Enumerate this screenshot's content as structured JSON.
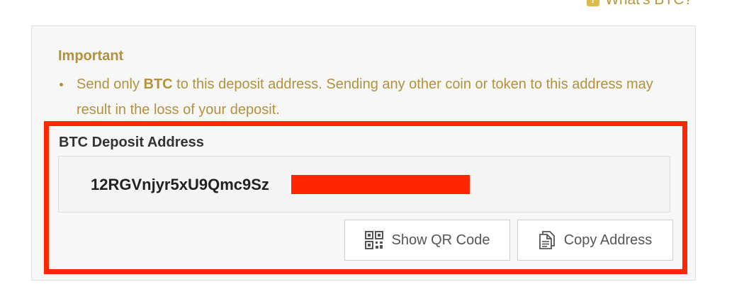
{
  "top_link": {
    "label": "What's BTC?",
    "icon": "question-icon"
  },
  "important": {
    "title": "Important",
    "text_before": "Send only ",
    "coin": "BTC",
    "text_after": " to this deposit address. Sending any other coin or token to this address may result in the loss of your deposit."
  },
  "deposit": {
    "label": "BTC Deposit Address",
    "address_visible": "12RGVnjyr5xU9Qmc9Sz"
  },
  "buttons": {
    "show_qr": "Show QR Code",
    "copy_address": "Copy Address"
  },
  "colors": {
    "accent_gold": "#b5913a",
    "highlight_red": "#ff2600"
  },
  "icons": {
    "qr": "qr-code-icon",
    "copy": "copy-document-icon"
  }
}
